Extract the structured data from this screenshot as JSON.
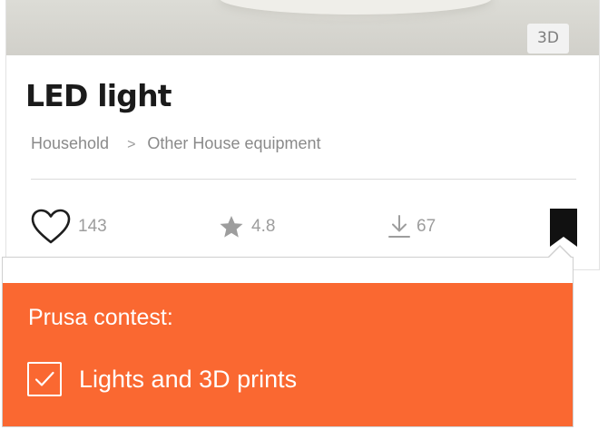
{
  "card": {
    "badge": "3D",
    "title": "LED light",
    "breadcrumb": {
      "category": "Household",
      "separator": ">",
      "subcategory": "Other House equipment"
    },
    "stats": {
      "likes": "143",
      "rating": "4.8",
      "downloads": "67"
    },
    "icons": {
      "likes": "heart-icon",
      "rating": "star-icon",
      "downloads": "download-icon",
      "bookmark": "bookmark-icon"
    }
  },
  "contest_popover": {
    "heading": "Prusa contest:",
    "option": {
      "label": "Lights and 3D prints",
      "checked": true
    }
  },
  "colors": {
    "accent": "#fa6831",
    "title": "#1b1b1b",
    "muted": "#9d9d9d"
  }
}
